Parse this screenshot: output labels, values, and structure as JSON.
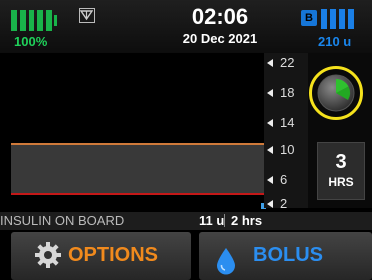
{
  "status": {
    "battery_percent": "100%",
    "time": "02:06",
    "date": "20 Dec 2021",
    "b_badge": "B",
    "insulin_units": "210 u"
  },
  "graph": {
    "axis_ticks": [
      "22",
      "18",
      "14",
      "10",
      "6",
      "2"
    ]
  },
  "timeframe": {
    "hours": "3",
    "unit": "HRS"
  },
  "iob": {
    "label": "INSULIN ON BOARD",
    "units": "11 u",
    "hours": "2 hrs"
  },
  "buttons": {
    "options": "OPTIONS",
    "bolus": "BOLUS"
  },
  "colors": {
    "battery": "#19b34a",
    "cartridge": "#1a7fe6",
    "options_text": "#f18a1d",
    "bolus_text": "#2b8ef0",
    "dial_highlight": "#f5e21c"
  }
}
